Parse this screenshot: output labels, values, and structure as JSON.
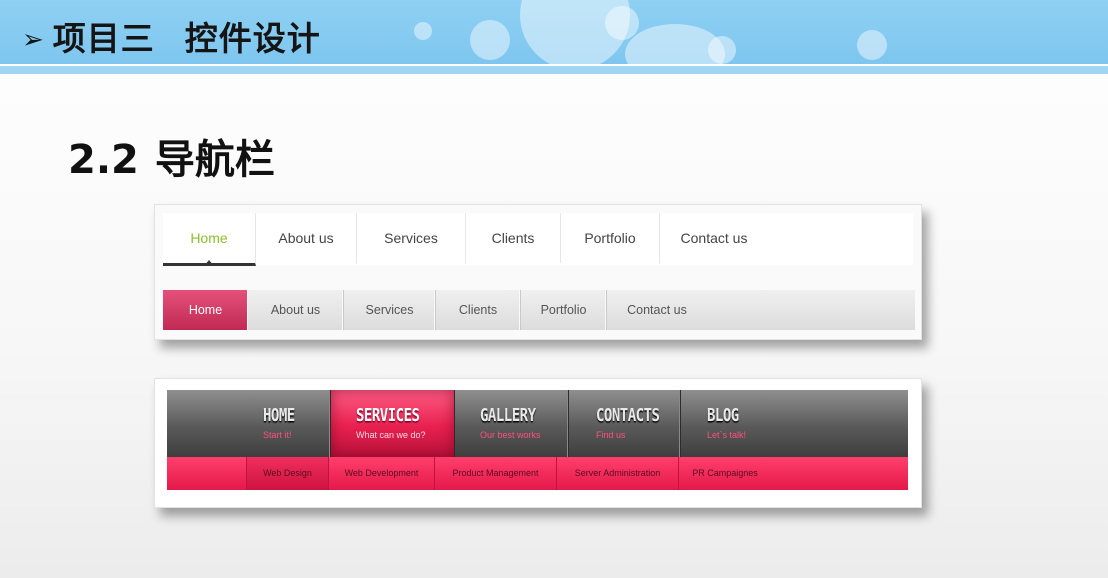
{
  "header": {
    "arrow": "➢",
    "title_part1": "项目三",
    "title_part2": "控件设计"
  },
  "section": {
    "number": "2.2",
    "title": "导航栏"
  },
  "nav_a": {
    "items": [
      "Home",
      "About us",
      "Services",
      "Clients",
      "Portfolio",
      "Contact us"
    ],
    "active_color": "#8cbd2e"
  },
  "nav_b": {
    "items": [
      "Home",
      "About us",
      "Services",
      "Clients",
      "Portfolio",
      "Contact us"
    ],
    "active_color": "#d63a66"
  },
  "nav_c": {
    "items": [
      {
        "label": "HOME",
        "sub": "Start it!"
      },
      {
        "label": "SERVICES",
        "sub": "What can we do?"
      },
      {
        "label": "GALLERY",
        "sub": "Our best works"
      },
      {
        "label": "CONTACTS",
        "sub": "Find us"
      },
      {
        "label": "BLOG",
        "sub": "Let`s talk!"
      }
    ],
    "accent_color": "#e8204f"
  },
  "nav_d": {
    "items": [
      "Web Design",
      "Web Development",
      "Product Management",
      "Server Administration",
      "PR Campaignes"
    ]
  }
}
